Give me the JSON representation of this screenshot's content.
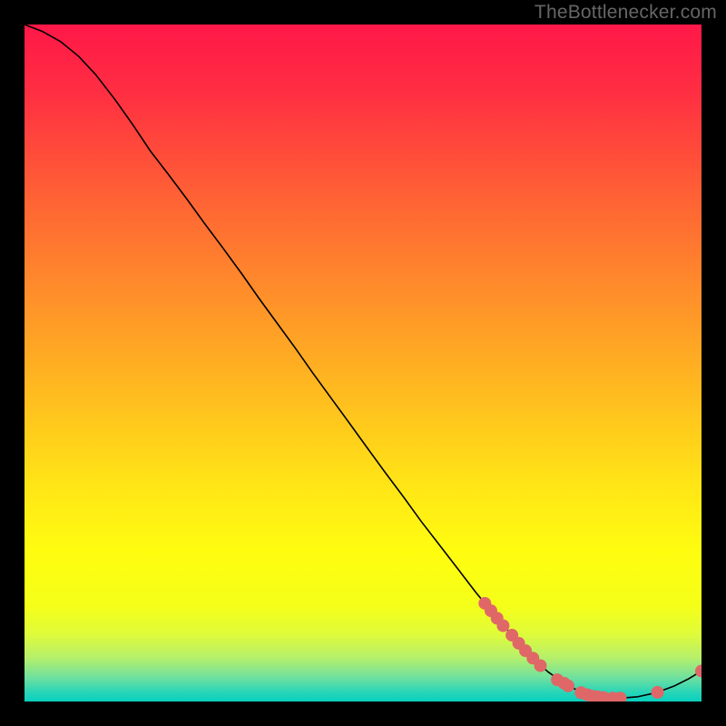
{
  "watermark": "TheBottlenecker.com",
  "chart_data": {
    "type": "line",
    "title": "",
    "xlabel": "",
    "ylabel": "",
    "xlim": [
      0,
      100
    ],
    "ylim": [
      0,
      100
    ],
    "grid": false,
    "background_gradient": {
      "stops": [
        {
          "offset": 0.0,
          "color": "#ff1848"
        },
        {
          "offset": 0.1,
          "color": "#ff2e42"
        },
        {
          "offset": 0.25,
          "color": "#ff6035"
        },
        {
          "offset": 0.4,
          "color": "#ff8f2a"
        },
        {
          "offset": 0.55,
          "color": "#ffbd1f"
        },
        {
          "offset": 0.68,
          "color": "#ffe516"
        },
        {
          "offset": 0.78,
          "color": "#fffd10"
        },
        {
          "offset": 0.86,
          "color": "#f4ff19"
        },
        {
          "offset": 0.9,
          "color": "#e0fb3a"
        },
        {
          "offset": 0.935,
          "color": "#b6f06a"
        },
        {
          "offset": 0.965,
          "color": "#6fe09f"
        },
        {
          "offset": 0.985,
          "color": "#2cd6b6"
        },
        {
          "offset": 1.0,
          "color": "#07d0bf"
        }
      ]
    },
    "curve": {
      "x": [
        0.0,
        2.6,
        5.3,
        8.0,
        10.6,
        13.3,
        16.0,
        18.6,
        21.3,
        24.0,
        26.6,
        29.3,
        32.0,
        34.6,
        37.3,
        40.0,
        42.6,
        45.3,
        48.0,
        50.6,
        53.3,
        56.0,
        58.6,
        61.3,
        64.0,
        66.6,
        69.3,
        72.0,
        74.6,
        77.3,
        80.0,
        82.6,
        85.3,
        88.0,
        90.6,
        93.3,
        96.0,
        98.0,
        100.0
      ],
      "y": [
        100.0,
        99.0,
        97.5,
        95.3,
        92.5,
        89.0,
        85.2,
        81.3,
        77.8,
        74.2,
        70.6,
        67.0,
        63.3,
        59.6,
        55.9,
        52.2,
        48.5,
        44.8,
        41.1,
        37.5,
        33.8,
        30.2,
        26.6,
        23.1,
        19.6,
        16.2,
        12.9,
        9.8,
        6.9,
        4.4,
        2.5,
        1.2,
        0.6,
        0.5,
        0.7,
        1.3,
        2.3,
        3.3,
        4.5
      ]
    },
    "marker_series": {
      "color": "#e06767",
      "radius_px": 7,
      "points": [
        {
          "x": 68.0,
          "y": 14.5
        },
        {
          "x": 68.9,
          "y": 13.4
        },
        {
          "x": 69.8,
          "y": 12.3
        },
        {
          "x": 70.7,
          "y": 11.2
        },
        {
          "x": 72.0,
          "y": 9.8
        },
        {
          "x": 73.0,
          "y": 8.6
        },
        {
          "x": 74.0,
          "y": 7.5
        },
        {
          "x": 75.1,
          "y": 6.4
        },
        {
          "x": 76.2,
          "y": 5.3
        },
        {
          "x": 78.7,
          "y": 3.2
        },
        {
          "x": 79.7,
          "y": 2.7
        },
        {
          "x": 80.3,
          "y": 2.3
        },
        {
          "x": 82.2,
          "y": 1.3
        },
        {
          "x": 83.1,
          "y": 1.0
        },
        {
          "x": 83.8,
          "y": 0.8
        },
        {
          "x": 84.6,
          "y": 0.7
        },
        {
          "x": 85.5,
          "y": 0.6
        },
        {
          "x": 86.9,
          "y": 0.5
        },
        {
          "x": 88.0,
          "y": 0.5
        },
        {
          "x": 93.5,
          "y": 1.35
        },
        {
          "x": 100.0,
          "y": 4.5
        }
      ]
    }
  }
}
